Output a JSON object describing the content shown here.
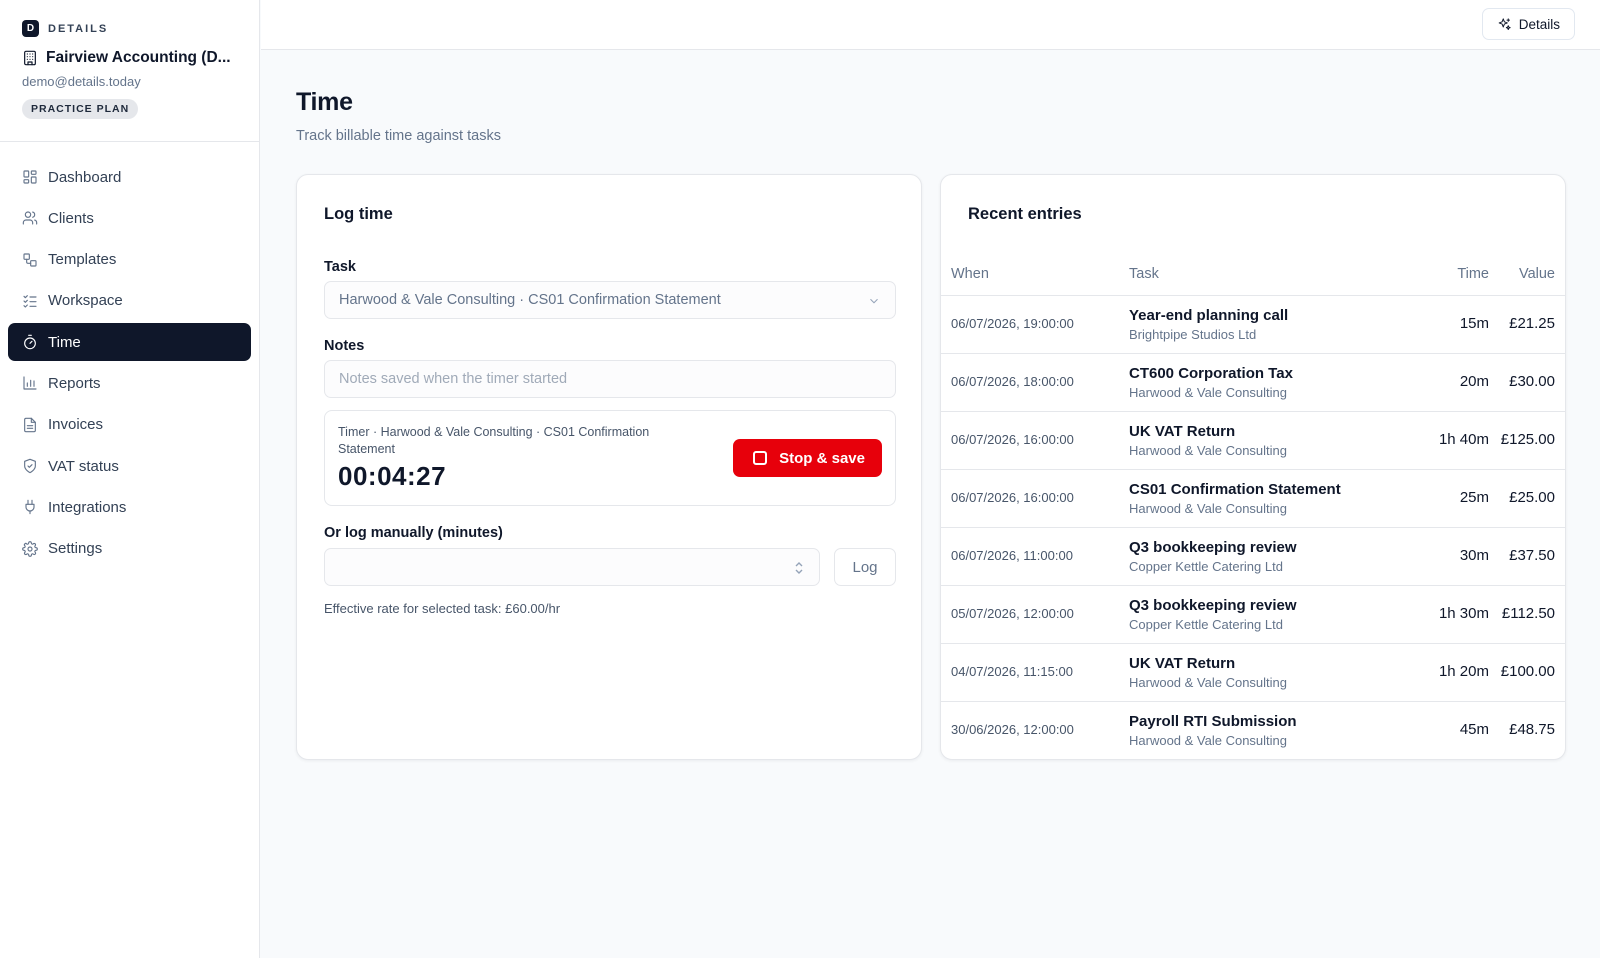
{
  "brand": {
    "logo_letter": "D",
    "name": "DETAILS"
  },
  "org": {
    "name": "Fairview Accounting (D...",
    "email": "demo@details.today",
    "plan": "PRACTICE PLAN"
  },
  "nav": [
    {
      "label": "Dashboard",
      "icon": "dashboard-icon",
      "active": false
    },
    {
      "label": "Clients",
      "icon": "users-icon",
      "active": false
    },
    {
      "label": "Templates",
      "icon": "templates-icon",
      "active": false
    },
    {
      "label": "Workspace",
      "icon": "checklist-icon",
      "active": false
    },
    {
      "label": "Time",
      "icon": "timer-icon",
      "active": true
    },
    {
      "label": "Reports",
      "icon": "bar-chart-icon",
      "active": false
    },
    {
      "label": "Invoices",
      "icon": "document-icon",
      "active": false
    },
    {
      "label": "VAT status",
      "icon": "shield-check-icon",
      "active": false
    },
    {
      "label": "Integrations",
      "icon": "plug-icon",
      "active": false
    },
    {
      "label": "Settings",
      "icon": "gear-icon",
      "active": false
    }
  ],
  "topbar": {
    "details_label": "Details",
    "details_icon": "sparkles-icon"
  },
  "page": {
    "title": "Time",
    "subtitle": "Track billable time against tasks"
  },
  "log_time": {
    "title": "Log time",
    "task_label": "Task",
    "task_value": "Harwood & Vale Consulting · CS01 Confirmation Statement",
    "notes_label": "Notes",
    "notes_placeholder": "Notes saved when the timer started",
    "timer_label": "Timer · Harwood & Vale Consulting · CS01 Confirmation Statement",
    "timer_value": "00:04:27",
    "stop_label": "Stop & save",
    "manual_label": "Or log manually (minutes)",
    "log_button": "Log",
    "rate_note": "Effective rate for selected task: £60.00/hr"
  },
  "recent": {
    "title": "Recent entries",
    "columns": {
      "when": "When",
      "task": "Task",
      "time": "Time",
      "value": "Value"
    },
    "rows": [
      {
        "when": "06/07/2026, 19:00:00",
        "task": "Year-end planning call",
        "client": "Brightpipe Studios Ltd",
        "time": "15m",
        "value": "£21.25"
      },
      {
        "when": "06/07/2026, 18:00:00",
        "task": "CT600 Corporation Tax",
        "client": "Harwood & Vale Consulting",
        "time": "20m",
        "value": "£30.00"
      },
      {
        "when": "06/07/2026, 16:00:00",
        "task": "UK VAT Return",
        "client": "Harwood & Vale Consulting",
        "time": "1h 40m",
        "value": "£125.00"
      },
      {
        "when": "06/07/2026, 16:00:00",
        "task": "CS01 Confirmation Statement",
        "client": "Harwood & Vale Consulting",
        "time": "25m",
        "value": "£25.00"
      },
      {
        "when": "06/07/2026, 11:00:00",
        "task": "Q3 bookkeeping review",
        "client": "Copper Kettle Catering Ltd",
        "time": "30m",
        "value": "£37.50"
      },
      {
        "when": "05/07/2026, 12:00:00",
        "task": "Q3 bookkeeping review",
        "client": "Copper Kettle Catering Ltd",
        "time": "1h 30m",
        "value": "£112.50"
      },
      {
        "when": "04/07/2026, 11:15:00",
        "task": "UK VAT Return",
        "client": "Harwood & Vale Consulting",
        "time": "1h 20m",
        "value": "£100.00"
      },
      {
        "when": "30/06/2026, 12:00:00",
        "task": "Payroll RTI Submission",
        "client": "Harwood & Vale Consulting",
        "time": "45m",
        "value": "£48.75"
      }
    ]
  },
  "colors": {
    "accent": "#0f172a",
    "stop": "#e7000b",
    "muted": "#64748b"
  }
}
